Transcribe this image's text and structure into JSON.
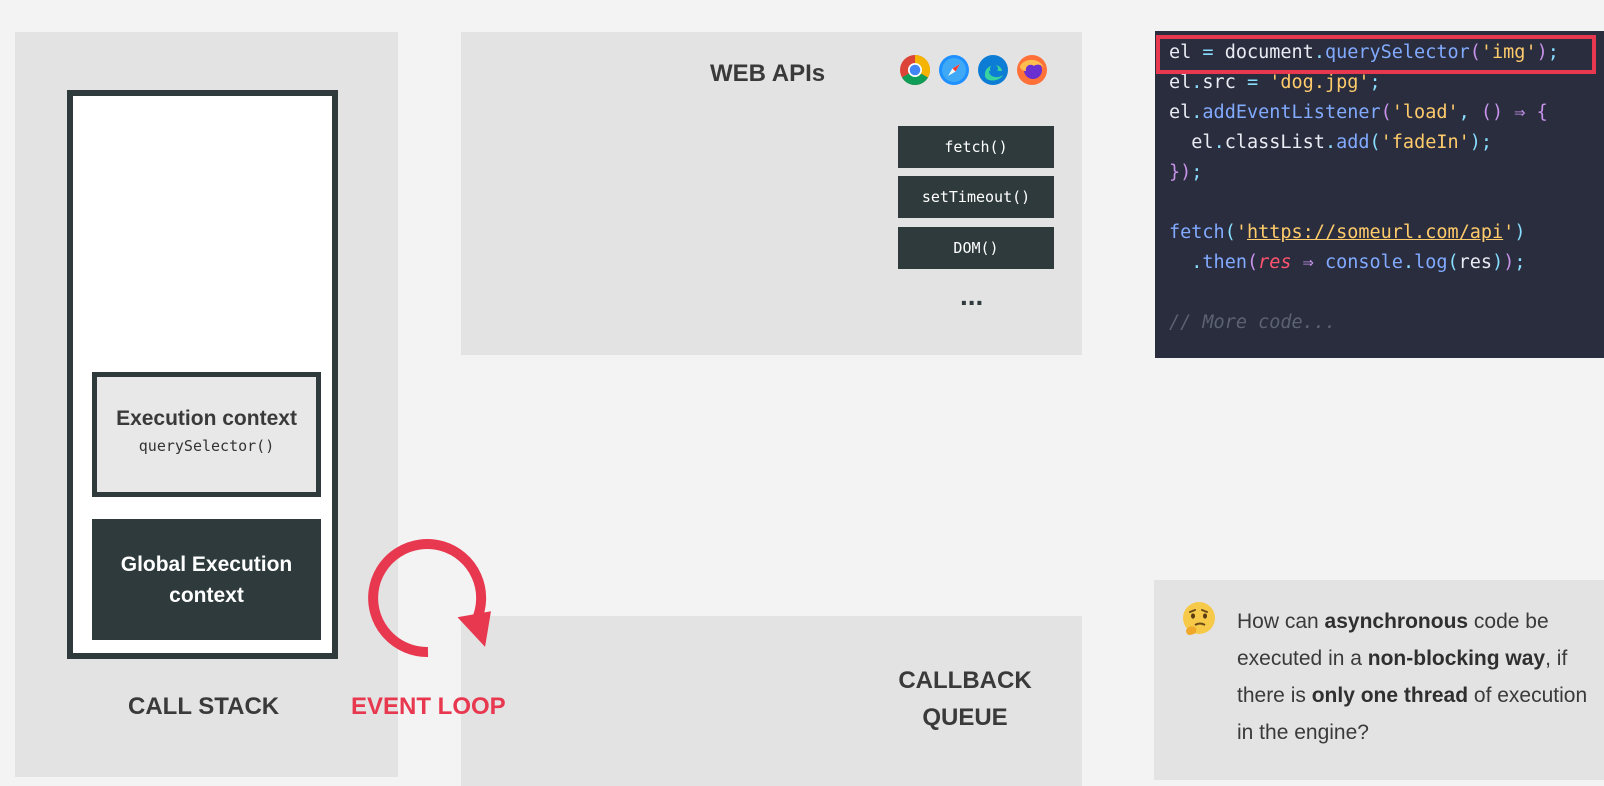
{
  "call_stack": {
    "label": "CALL STACK",
    "execution_context_title": "Execution context",
    "execution_context_fn": "querySelector()",
    "global_context": "Global Execution context"
  },
  "event_loop": {
    "label": "EVENT LOOP",
    "color": "#e8384f"
  },
  "web_apis": {
    "label": "WEB APIs",
    "browser_icons": [
      "chrome-icon",
      "safari-icon",
      "edge-icon",
      "firefox-icon"
    ],
    "apis": [
      "fetch()",
      "setTimeout()",
      "DOM()"
    ],
    "more": "..."
  },
  "callback_queue": {
    "label_line1": "CALLBACK",
    "label_line2": "QUEUE"
  },
  "code": {
    "l1_a": "el",
    "l1_b": " = ",
    "l1_c": "document",
    "l1_d": ".",
    "l1_e": "querySelector",
    "l1_f": "(",
    "l1_g": "'img'",
    "l1_h": ")",
    "l1_i": ";",
    "l2_a": "el",
    "l2_b": ".",
    "l2_c": "src",
    "l2_d": " = ",
    "l2_e": "'dog.jpg'",
    "l2_f": ";",
    "l3_a": "el",
    "l3_b": ".",
    "l3_c": "addEventListener",
    "l3_d": "(",
    "l3_e": "'load'",
    "l3_f": ", ",
    "l3_g": "()",
    "l3_h": " ⇒ ",
    "l3_i": "{",
    "l4_a": "  el",
    "l4_b": ".",
    "l4_c": "classList",
    "l4_d": ".",
    "l4_e": "add",
    "l4_f": "(",
    "l4_g": "'fadeIn'",
    "l4_h": ")",
    "l4_i": ";",
    "l5_a": "}",
    "l5_b": ")",
    "l5_c": ";",
    "l6_a": "fetch",
    "l6_b": "(",
    "l6_c": "'",
    "l6_d": "https://someurl.com/api",
    "l6_e": "'",
    "l6_f": ")",
    "l7_a": "  .",
    "l7_b": "then",
    "l7_c": "(",
    "l7_d": "res",
    "l7_e": " ⇒ ",
    "l7_f": "console",
    "l7_g": ".",
    "l7_h": "log",
    "l7_i": "(",
    "l7_j": "res",
    "l7_k": ")",
    "l7_l": ")",
    "l7_m": ";",
    "l8": "// More code...",
    "highlight_color": "#e8384f"
  },
  "question": {
    "emoji": "thinking-face-icon",
    "t1": "How can ",
    "b1": "asynchronous",
    "t2": " code be executed in a ",
    "b2": "non-blocking way",
    "t3": ", if there is ",
    "b3": "only one thread",
    "t4": " of execution in the engine?"
  },
  "colors": {
    "dark_box": "#2f3a3c",
    "panel": "#e3e3e3",
    "background": "#f3f3f3",
    "code_bg": "#292d3e"
  }
}
